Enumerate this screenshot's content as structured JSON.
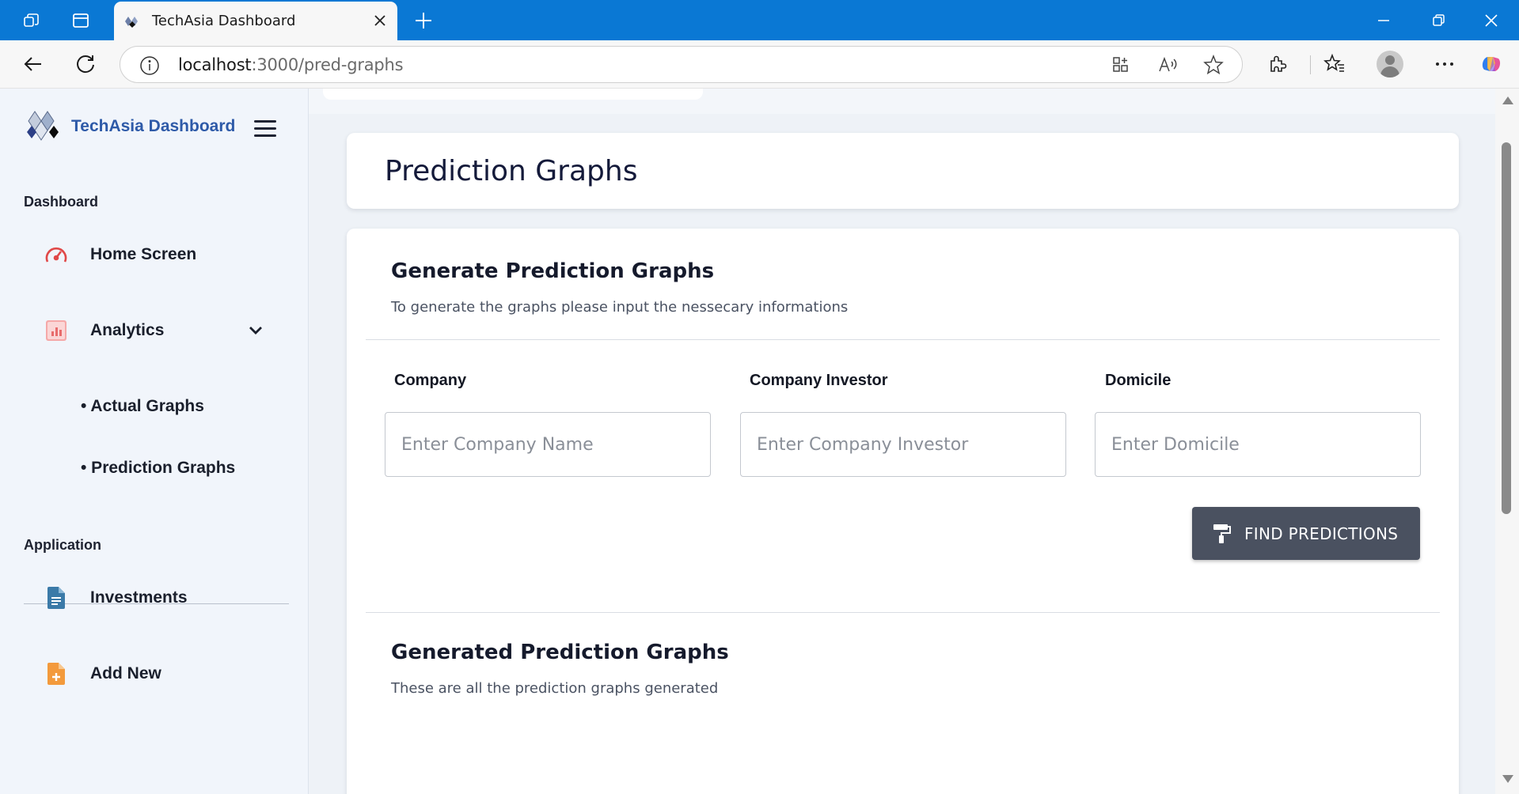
{
  "browser": {
    "tab_title": "TechAsia Dashboard",
    "url_host": "localhost",
    "url_path": ":3000/pred-graphs"
  },
  "sidebar": {
    "brand_title": "TechAsia Dashboard",
    "sections": {
      "dashboard": "Dashboard",
      "application": "Application"
    },
    "items": {
      "home": "Home Screen",
      "analytics": "Analytics",
      "actual_graphs": "• Actual Graphs",
      "prediction_graphs": "• Prediction Graphs",
      "investments": "Investments",
      "add_new": "Add New"
    }
  },
  "main": {
    "page_title": "Prediction Graphs",
    "generate": {
      "title": "Generate Prediction Graphs",
      "subtitle": "To generate the graphs please input the nessecary informations"
    },
    "fields": {
      "company_label": "Company",
      "company_placeholder": "Enter Company Name",
      "investor_label": "Company Investor",
      "investor_placeholder": "Enter Company Investor",
      "domicile_label": "Domicile",
      "domicile_placeholder": "Enter Domicile"
    },
    "find_button": "FIND PREDICTIONS",
    "generated": {
      "title": "Generated Prediction Graphs",
      "subtitle": "These are all the prediction graphs generated"
    }
  },
  "colors": {
    "titlebar": "#0a78d4",
    "brand": "#2e5aa8",
    "button": "#4a5160",
    "sidebar_bg": "#f1f5fb",
    "home_icon": "#e04848",
    "analytics_icon": "#f08a8a",
    "investments_icon": "#3b7aa8",
    "add_new_icon": "#f39a3c"
  },
  "icons": {
    "tabs_actions": "tab-actions-icon",
    "vertical_tabs": "vertical-tabs-icon",
    "home": "speedometer-icon",
    "analytics": "bar-chart-icon",
    "investments": "document-icon",
    "add_new": "file-plus-icon",
    "find": "paint-roller-icon"
  }
}
